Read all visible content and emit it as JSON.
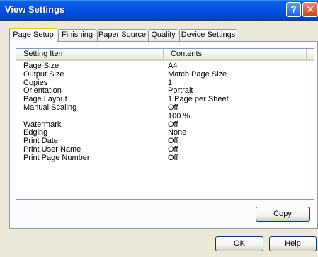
{
  "window": {
    "title": "View Settings"
  },
  "titlebar": {
    "help_glyph": "?",
    "close_glyph": "✕"
  },
  "tabs": [
    {
      "label": "Page Setup",
      "active": true
    },
    {
      "label": "Finishing",
      "active": false
    },
    {
      "label": "Paper Source",
      "active": false
    },
    {
      "label": "Quality",
      "active": false
    },
    {
      "label": "Device Settings",
      "active": false
    }
  ],
  "list": {
    "columns": [
      "Setting Item",
      "Contents"
    ],
    "rows": [
      {
        "item": "Page Size",
        "contents": "A4"
      },
      {
        "item": "Output Size",
        "contents": "Match Page Size"
      },
      {
        "item": "Copies",
        "contents": "1"
      },
      {
        "item": "Orientation",
        "contents": "Portrait"
      },
      {
        "item": "Page Layout",
        "contents": "1 Page per Sheet"
      },
      {
        "item": "Manual Scaling",
        "contents": "Off"
      },
      {
        "item": "",
        "contents": "100 %"
      },
      {
        "item": "Watermark",
        "contents": "Off"
      },
      {
        "item": "Edging",
        "contents": "None"
      },
      {
        "item": "Print Date",
        "contents": "Off"
      },
      {
        "item": "Print User Name",
        "contents": "Off"
      },
      {
        "item": "Print Page Number",
        "contents": "Off"
      }
    ]
  },
  "buttons": {
    "copy_label": "Copy",
    "ok_label": "OK",
    "help_label": "Help"
  }
}
